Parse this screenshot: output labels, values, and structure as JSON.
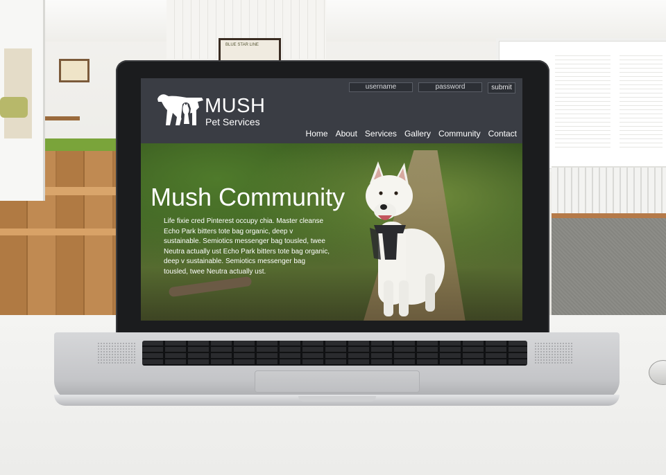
{
  "room": {
    "picture_text": "BLUE STAR LINE"
  },
  "site": {
    "login": {
      "username_placeholder": "username",
      "password_placeholder": "password",
      "submit_label": "submit"
    },
    "logo": {
      "title": "MUSH",
      "subtitle": "Pet Services"
    },
    "nav": [
      {
        "label": "Home"
      },
      {
        "label": "About"
      },
      {
        "label": "Services"
      },
      {
        "label": "Gallery"
      },
      {
        "label": "Community"
      },
      {
        "label": "Contact"
      }
    ],
    "hero": {
      "title": "Mush Community",
      "body": "Life fixie cred Pinterest occupy chia. Master cleanse Echo Park bitters tote bag organic, deep v sustainable. Semiotics messenger bag tousled, twee Neutra actually ust Echo Park bitters tote bag organic, deep v sustainable. Semiotics messenger bag tousled, twee Neutra actually ust."
    },
    "colors": {
      "header_bg": "#3a3d44",
      "text": "#ffffff"
    }
  }
}
